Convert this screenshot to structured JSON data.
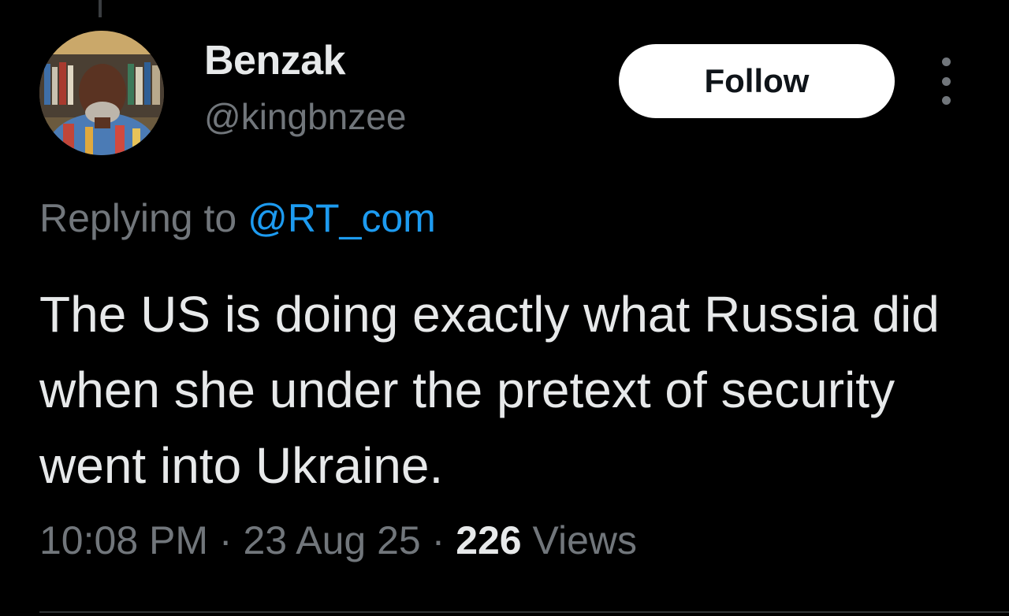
{
  "user": {
    "name": "Benzak",
    "handle": "@kingbnzee"
  },
  "actions": {
    "follow_label": "Follow"
  },
  "reply": {
    "prefix": "Replying to",
    "to": "@RT_com"
  },
  "tweet": {
    "text": "The US is doing exactly what Russia did when she under the pretext of security went into Ukraine."
  },
  "meta": {
    "time": "10:08 PM",
    "separator": "·",
    "date": "23 Aug 25",
    "views_count": "226",
    "views_label": "Views"
  },
  "colors": {
    "background": "#000000",
    "primary_text": "#e7e9ea",
    "secondary_text": "#71767b",
    "link": "#1d9bf0",
    "follow_button_bg": "#ffffff"
  },
  "icons": {
    "more": "more-vertical-icon"
  }
}
